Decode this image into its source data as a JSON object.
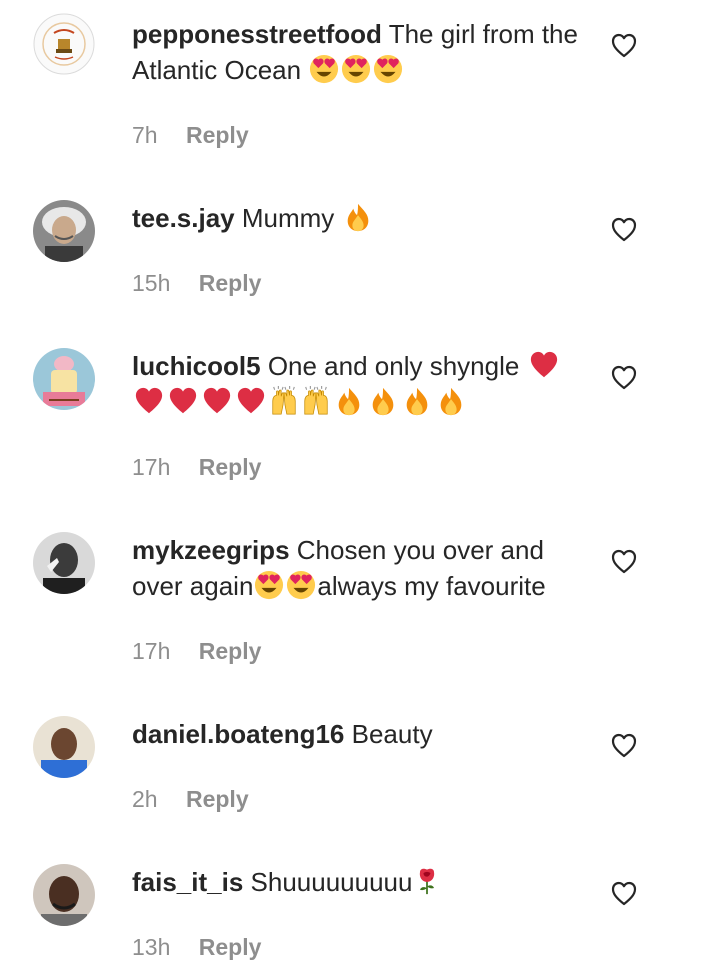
{
  "comments": [
    {
      "username": "pepponesstreetfood",
      "text": "The girl from the Atlantic Ocean",
      "time": "7h",
      "reply": "Reply",
      "avatar_logo_text": "PEPPONES STREET FOOD",
      "emojis": [
        "heart-eyes-emoji",
        "heart-eyes-emoji",
        "heart-eyes-emoji"
      ]
    },
    {
      "username": "tee.s.jay",
      "text": "Mummy",
      "time": "15h",
      "reply": "Reply",
      "emojis": [
        "fire-emoji"
      ]
    },
    {
      "username": "luchicool5",
      "text": "One and only shyngle",
      "time": "17h",
      "reply": "Reply",
      "emojis": [
        "red-heart-emoji",
        "red-heart-emoji",
        "red-heart-emoji",
        "red-heart-emoji",
        "red-heart-emoji",
        "raising-hands-emoji",
        "raising-hands-emoji",
        "fire-emoji",
        "fire-emoji",
        "fire-emoji",
        "fire-emoji"
      ]
    },
    {
      "username": "mykzeegrips",
      "text_before": "Chosen you over and over again",
      "text_after": "always my favourite",
      "time": "17h",
      "reply": "Reply",
      "emojis": [
        "heart-eyes-emoji",
        "heart-eyes-emoji"
      ]
    },
    {
      "username": "daniel.boateng16",
      "text": "Beauty",
      "time": "2h",
      "reply": "Reply",
      "emojis": []
    },
    {
      "username": "fais_it_is",
      "text": "Shuuuuuuuuu",
      "time": "13h",
      "reply": "Reply",
      "emojis": [
        "rose-emoji"
      ]
    }
  ],
  "colors": {
    "text": "#262626",
    "secondary": "#8e8e8e",
    "heart": "#e0245e",
    "fire": "#f4900c",
    "emoji_face": "#ffcc4d"
  }
}
